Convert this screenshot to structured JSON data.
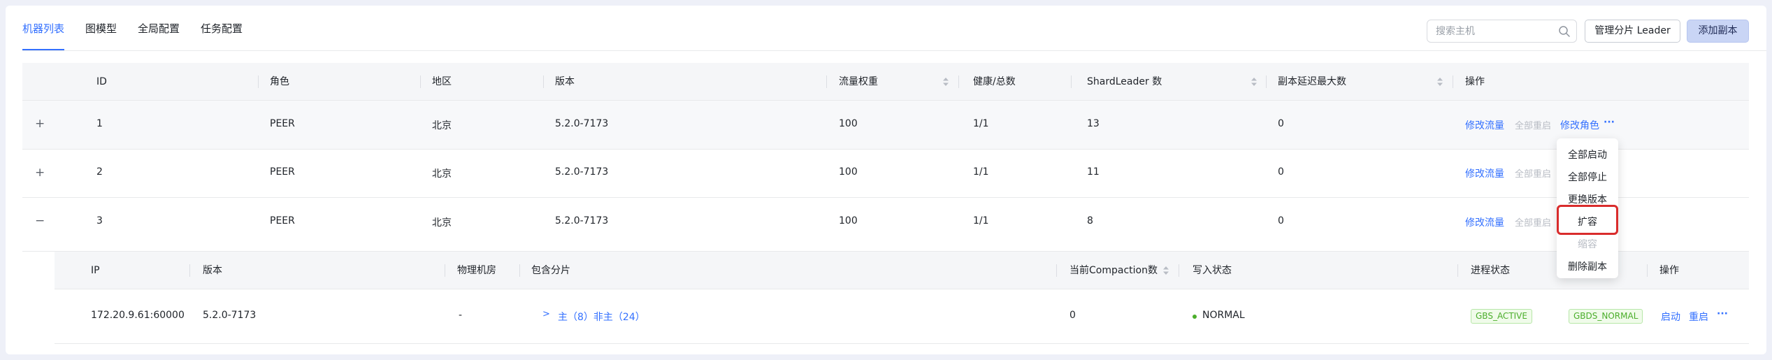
{
  "tabs": [
    "机器列表",
    "图模型",
    "全局配置",
    "任务配置"
  ],
  "search": {
    "placeholder": "搜索主机"
  },
  "buttons": {
    "manage_leader": "管理分片 Leader",
    "add_replica": "添加副本"
  },
  "table": {
    "columns": [
      "ID",
      "角色",
      "地区",
      "版本",
      "流量权重",
      "健康/总数",
      "ShardLeader 数",
      "副本延迟最大数",
      "操作"
    ],
    "rows": [
      {
        "expander": "+",
        "id": "1",
        "role": "PEER",
        "region": "北京",
        "version": "5.2.0-7173",
        "weight": "100",
        "health": "1/1",
        "shard_leader": "13",
        "replica_delay": "0"
      },
      {
        "expander": "+",
        "id": "2",
        "role": "PEER",
        "region": "北京",
        "version": "5.2.0-7173",
        "weight": "100",
        "health": "1/1",
        "shard_leader": "11",
        "replica_delay": "0"
      },
      {
        "expander": "−",
        "id": "3",
        "role": "PEER",
        "region": "北京",
        "version": "5.2.0-7173",
        "weight": "100",
        "health": "1/1",
        "shard_leader": "8",
        "replica_delay": "0"
      }
    ],
    "actions": {
      "modify_traffic": "修改流量",
      "restart_all": "全部重启",
      "modify_role": "修改角色",
      "more": "···"
    }
  },
  "subtable": {
    "columns": [
      "IP",
      "版本",
      "物理机房",
      "包含分片",
      "当前Compaction数",
      "写入状态",
      "进程状态",
      "操作"
    ],
    "row": {
      "ip": "172.20.9.61:60000",
      "version": "5.2.0-7173",
      "room": "-",
      "shards_arrow": ">",
      "shards": "主（8）非主（24）",
      "compaction": "0",
      "write_status": "NORMAL",
      "process_status_1": "GBS_ACTIVE",
      "process_status_2": "GBDS_NORMAL",
      "start": "启动",
      "restart": "重启",
      "more": "···"
    }
  },
  "dropdown": {
    "items": [
      {
        "label": "全部启动",
        "disabled": false
      },
      {
        "label": "全部停止",
        "disabled": false
      },
      {
        "label": "更换版本",
        "disabled": false
      },
      {
        "label": "扩容",
        "disabled": false
      },
      {
        "label": "缩容",
        "disabled": true
      },
      {
        "label": "删除副本",
        "disabled": false
      }
    ],
    "highlighted_item": "扩容"
  },
  "colors": {
    "accent": "#3370ff",
    "success": "#4bae2b",
    "highlight_border": "#d92c2c",
    "primary_button_bg": "#c9d5f5"
  },
  "icons": {
    "search": "search-icon",
    "sort": "sort-icon",
    "chevron": "chevron-right-icon",
    "more": "more-icon"
  }
}
